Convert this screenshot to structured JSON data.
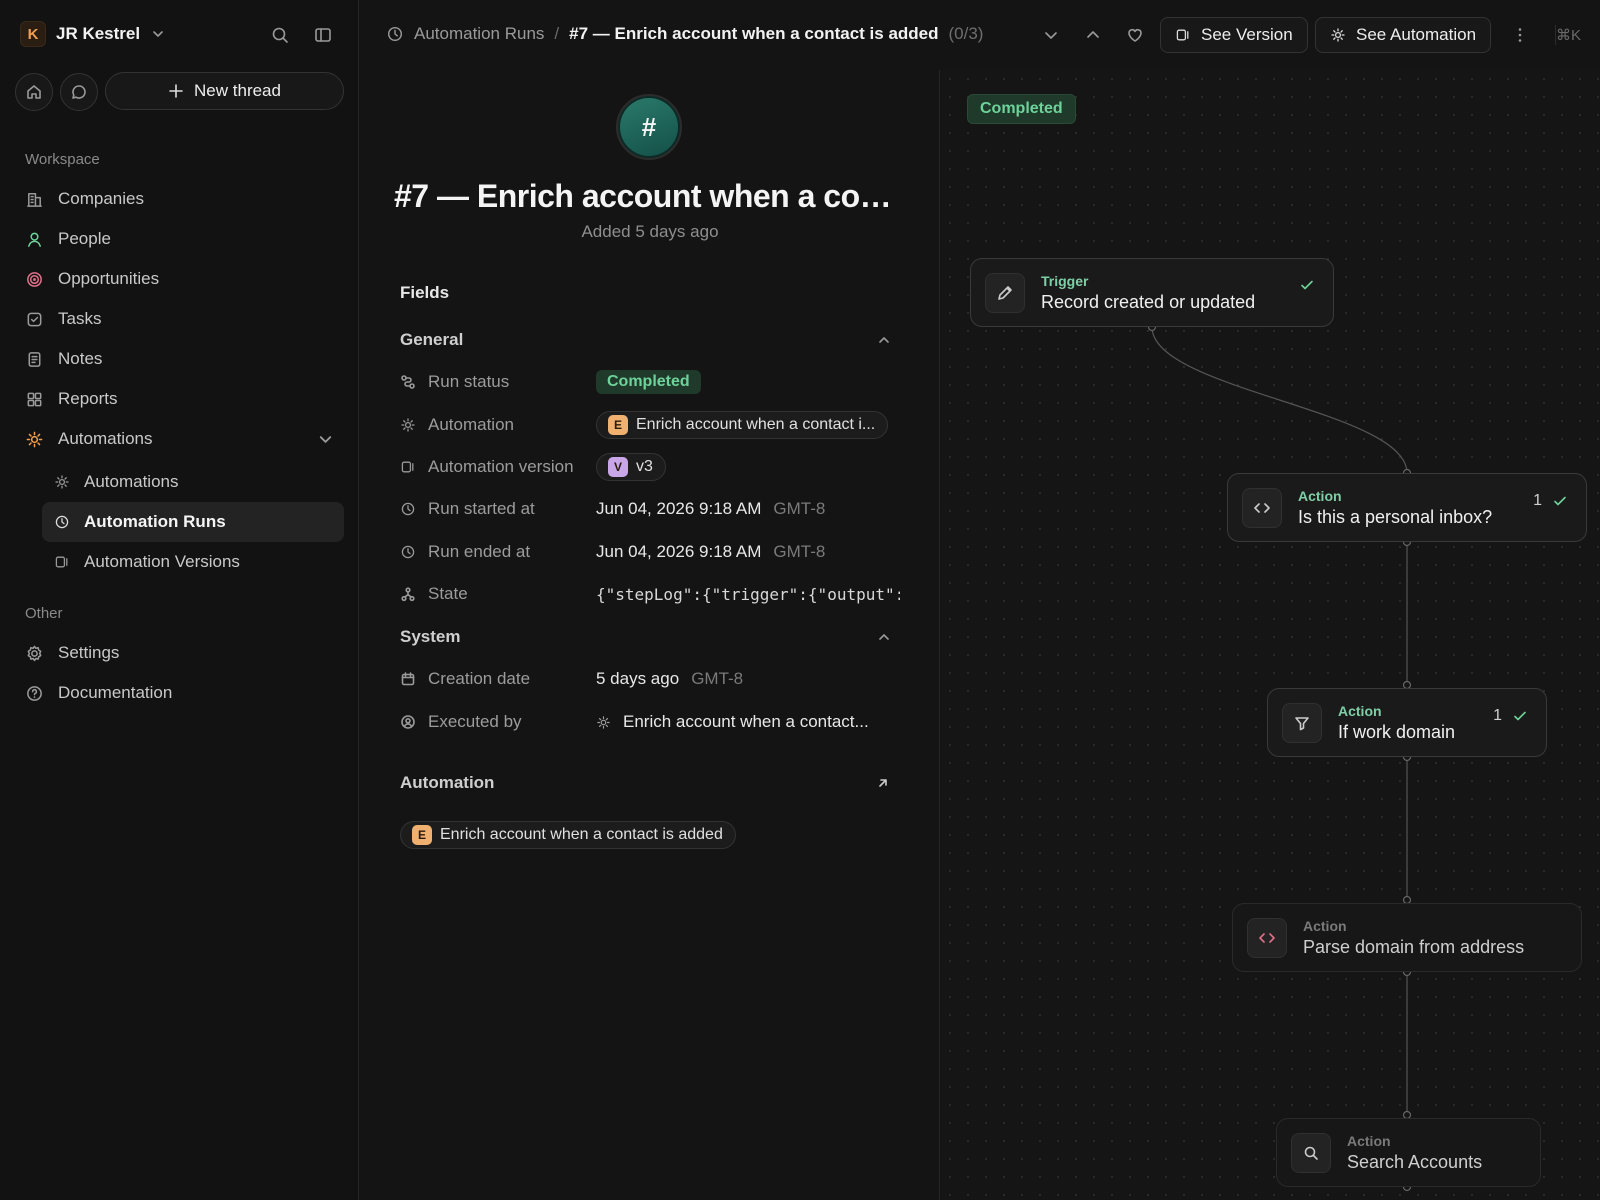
{
  "workspace": {
    "initial": "K",
    "name": "JR Kestrel"
  },
  "sidebar": {
    "new_thread": "New thread",
    "workspace_label": "Workspace",
    "items": [
      {
        "label": "Companies",
        "icon": "building-icon"
      },
      {
        "label": "People",
        "icon": "person-icon"
      },
      {
        "label": "Opportunities",
        "icon": "target-icon"
      },
      {
        "label": "Tasks",
        "icon": "checkbox-icon"
      },
      {
        "label": "Notes",
        "icon": "note-icon"
      },
      {
        "label": "Reports",
        "icon": "grid-icon"
      },
      {
        "label": "Automations",
        "icon": "sun-gear-icon"
      }
    ],
    "sub_items": [
      {
        "label": "Automations",
        "icon": "sun-gear-icon"
      },
      {
        "label": "Automation Runs",
        "icon": "clock-icon",
        "active": true
      },
      {
        "label": "Automation Versions",
        "icon": "version-icon"
      }
    ],
    "other_label": "Other",
    "other_items": [
      {
        "label": "Settings",
        "icon": "gear-icon"
      },
      {
        "label": "Documentation",
        "icon": "help-circle-icon"
      }
    ]
  },
  "topbar": {
    "crumb_parent": "Automation Runs",
    "crumb_sep": "/",
    "crumb_current": "#7 — Enrich account when a contact is added",
    "crumb_count": "(0/3)",
    "see_version": "See Version",
    "see_automation": "See Automation",
    "shortcut": "⌘K"
  },
  "record": {
    "avatar": "#",
    "title": "#7 — Enrich account when a contact is added",
    "subtitle": "Added 5 days ago",
    "fields_heading": "Fields",
    "general_heading": "General",
    "system_heading": "System",
    "run_status_label": "Run status",
    "run_status": "Completed",
    "automation_label": "Automation",
    "automation_letter": "E",
    "automation_value": "Enrich account when a contact i...",
    "version_label": "Automation version",
    "version_letter": "V",
    "version_value": "v3",
    "started_label": "Run started at",
    "started_value": "Jun 04, 2026 9:18 AM",
    "started_tz": "GMT-8",
    "ended_label": "Run ended at",
    "ended_value": "Jun 04, 2026 9:18 AM",
    "ended_tz": "GMT-8",
    "state_label": "State",
    "state_value": "{\"stepLog\":{\"trigger\":{\"output\":{",
    "creation_label": "Creation date",
    "creation_value": "5 days ago",
    "creation_tz": "GMT-8",
    "executed_label": "Executed by",
    "executed_value": "Enrich account when a contact...",
    "automation_section": "Automation",
    "automation_chip_letter": "E",
    "automation_chip": "Enrich account when a contact is added"
  },
  "flow": {
    "status": "Completed",
    "nodes": [
      {
        "kind": "Trigger",
        "title": "Record created or updated",
        "icon": "pencil-icon"
      },
      {
        "kind": "Action",
        "title": "Is this a personal inbox?",
        "icon": "code-icon",
        "count": "1"
      },
      {
        "kind": "Action",
        "title": "If work domain",
        "icon": "filter-icon",
        "count": "1"
      },
      {
        "kind": "Action",
        "title": "Parse domain from address",
        "icon": "code-icon"
      },
      {
        "kind": "Action",
        "title": "Search Accounts",
        "icon": "search-icon"
      }
    ]
  },
  "colors": {
    "background": "#141414",
    "success": "#6ed39a",
    "success_bg": "#1f3a2a",
    "orange_chip": "#f0b070",
    "purple_chip": "#c9a6e8"
  }
}
